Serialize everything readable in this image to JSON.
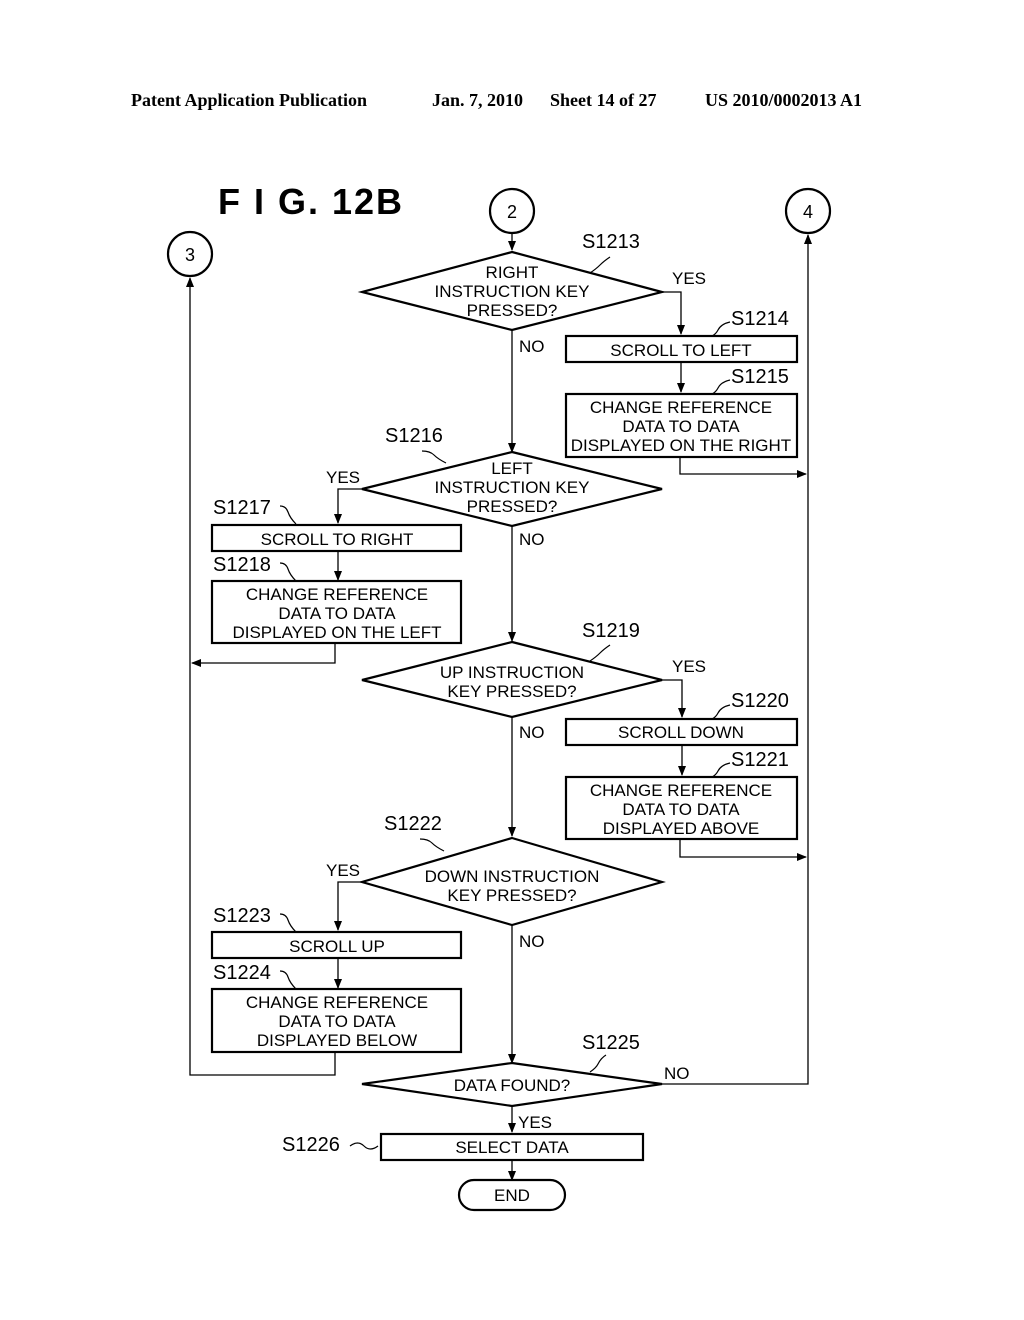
{
  "header": {
    "publication": "Patent Application Publication",
    "date": "Jan. 7, 2010",
    "sheet": "Sheet 14 of 27",
    "number": "US 2010/0002013 A1"
  },
  "figure": {
    "title": "F I G.  12B",
    "connectors": {
      "c2": "2",
      "c3": "3",
      "c4": "4"
    },
    "labels": {
      "yes": "YES",
      "no": "NO"
    },
    "steps": {
      "s1213": {
        "id": "S1213",
        "type": "decision",
        "lines": [
          "RIGHT",
          "INSTRUCTION KEY",
          "PRESSED?"
        ]
      },
      "s1214": {
        "id": "S1214",
        "type": "process",
        "lines": [
          "SCROLL TO LEFT"
        ]
      },
      "s1215": {
        "id": "S1215",
        "type": "process",
        "lines": [
          "CHANGE REFERENCE",
          "DATA TO DATA",
          "DISPLAYED ON THE RIGHT"
        ]
      },
      "s1216": {
        "id": "S1216",
        "type": "decision",
        "lines": [
          "LEFT",
          "INSTRUCTION KEY",
          "PRESSED?"
        ]
      },
      "s1217": {
        "id": "S1217",
        "type": "process",
        "lines": [
          "SCROLL TO RIGHT"
        ]
      },
      "s1218": {
        "id": "S1218",
        "type": "process",
        "lines": [
          "CHANGE REFERENCE",
          "DATA TO DATA",
          "DISPLAYED ON THE LEFT"
        ]
      },
      "s1219": {
        "id": "S1219",
        "type": "decision",
        "lines": [
          "UP INSTRUCTION",
          "KEY PRESSED?"
        ]
      },
      "s1220": {
        "id": "S1220",
        "type": "process",
        "lines": [
          "SCROLL DOWN"
        ]
      },
      "s1221": {
        "id": "S1221",
        "type": "process",
        "lines": [
          "CHANGE REFERENCE",
          "DATA TO DATA",
          "DISPLAYED ABOVE"
        ]
      },
      "s1222": {
        "id": "S1222",
        "type": "decision",
        "lines": [
          "DOWN INSTRUCTION",
          "KEY PRESSED?"
        ]
      },
      "s1223": {
        "id": "S1223",
        "type": "process",
        "lines": [
          "SCROLL UP"
        ]
      },
      "s1224": {
        "id": "S1224",
        "type": "process",
        "lines": [
          "CHANGE REFERENCE",
          "DATA TO DATA",
          "DISPLAYED BELOW"
        ]
      },
      "s1225": {
        "id": "S1225",
        "type": "decision",
        "lines": [
          "DATA FOUND?"
        ]
      },
      "s1226": {
        "id": "S1226",
        "type": "process",
        "lines": [
          "SELECT DATA"
        ]
      },
      "end": {
        "type": "terminal",
        "lines": [
          "END"
        ]
      }
    }
  }
}
